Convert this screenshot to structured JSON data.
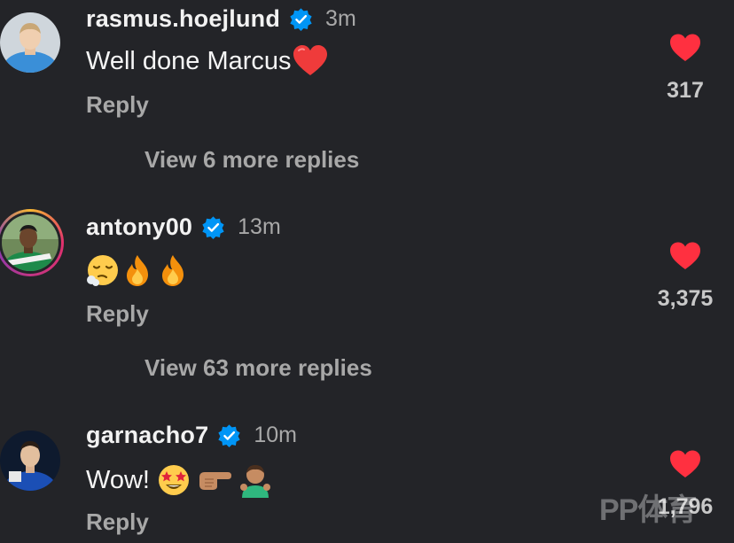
{
  "comments": [
    {
      "username": "rasmus.hoejlund",
      "time": "3m",
      "text": "Well done Marcus",
      "text_emoji": [
        "red-heart"
      ],
      "reply_label": "Reply",
      "view_more": "View 6 more replies",
      "likes": "317",
      "verified": true
    },
    {
      "username": "antony00",
      "time": "13m",
      "text": "",
      "text_emoji": [
        "exhaling-face",
        "fire",
        "fire"
      ],
      "reply_label": "Reply",
      "view_more": "View 63 more replies",
      "likes": "3,375",
      "verified": true,
      "has_story_ring": true
    },
    {
      "username": "garnacho7",
      "time": "10m",
      "text": "Wow!",
      "text_emoji": [
        "star-struck",
        "pointing-right",
        "man-gesturing-ok"
      ],
      "reply_label": "Reply",
      "likes": "1,796",
      "verified": true
    }
  ],
  "watermark": "PP体育",
  "colors": {
    "background": "#232428",
    "heart": "#ff3040",
    "verified": "#0095f6",
    "muted": "#a8a8a8"
  }
}
